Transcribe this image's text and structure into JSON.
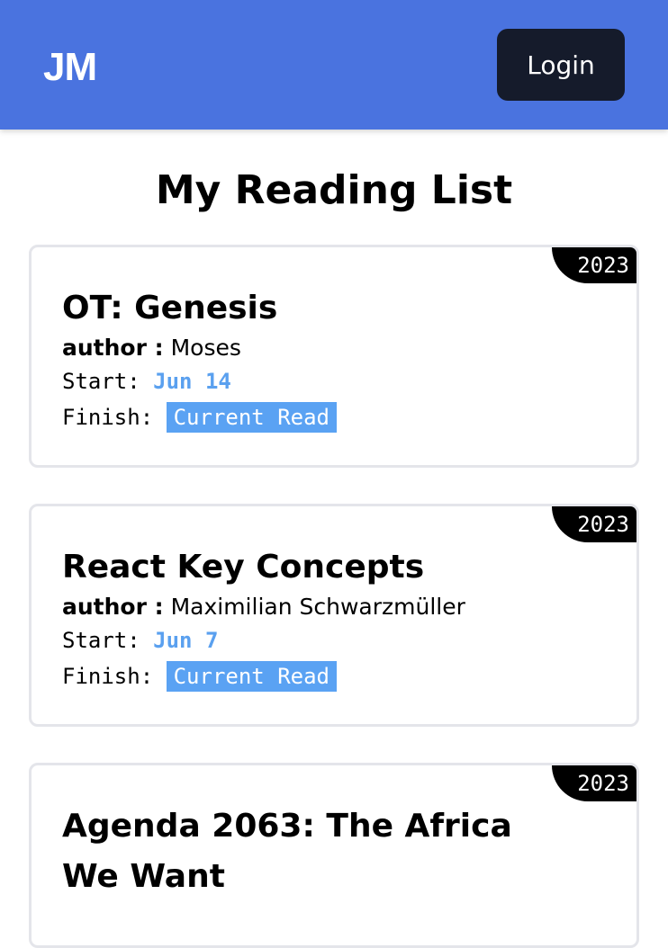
{
  "header": {
    "logo": "JM",
    "login_label": "Login"
  },
  "page": {
    "title": "My Reading List"
  },
  "books": [
    {
      "year": "2023",
      "title": "OT: Genesis",
      "author_label": "author :",
      "author": "Moses",
      "start_label": "Start:",
      "start": "Jun 14",
      "finish_label": "Finish:",
      "finish": "Current Read"
    },
    {
      "year": "2023",
      "title": "React Key Concepts",
      "author_label": "author :",
      "author": "Maximilian Schwarzmüller",
      "start_label": "Start:",
      "start": "Jun 7",
      "finish_label": "Finish:",
      "finish": "Current Read"
    },
    {
      "year": "2023",
      "title": "Agenda 2063: The Africa We Want"
    }
  ],
  "colors": {
    "header_bg": "#4a73df",
    "login_bg": "#151b2b",
    "accent_blue": "#5aa2f3"
  }
}
